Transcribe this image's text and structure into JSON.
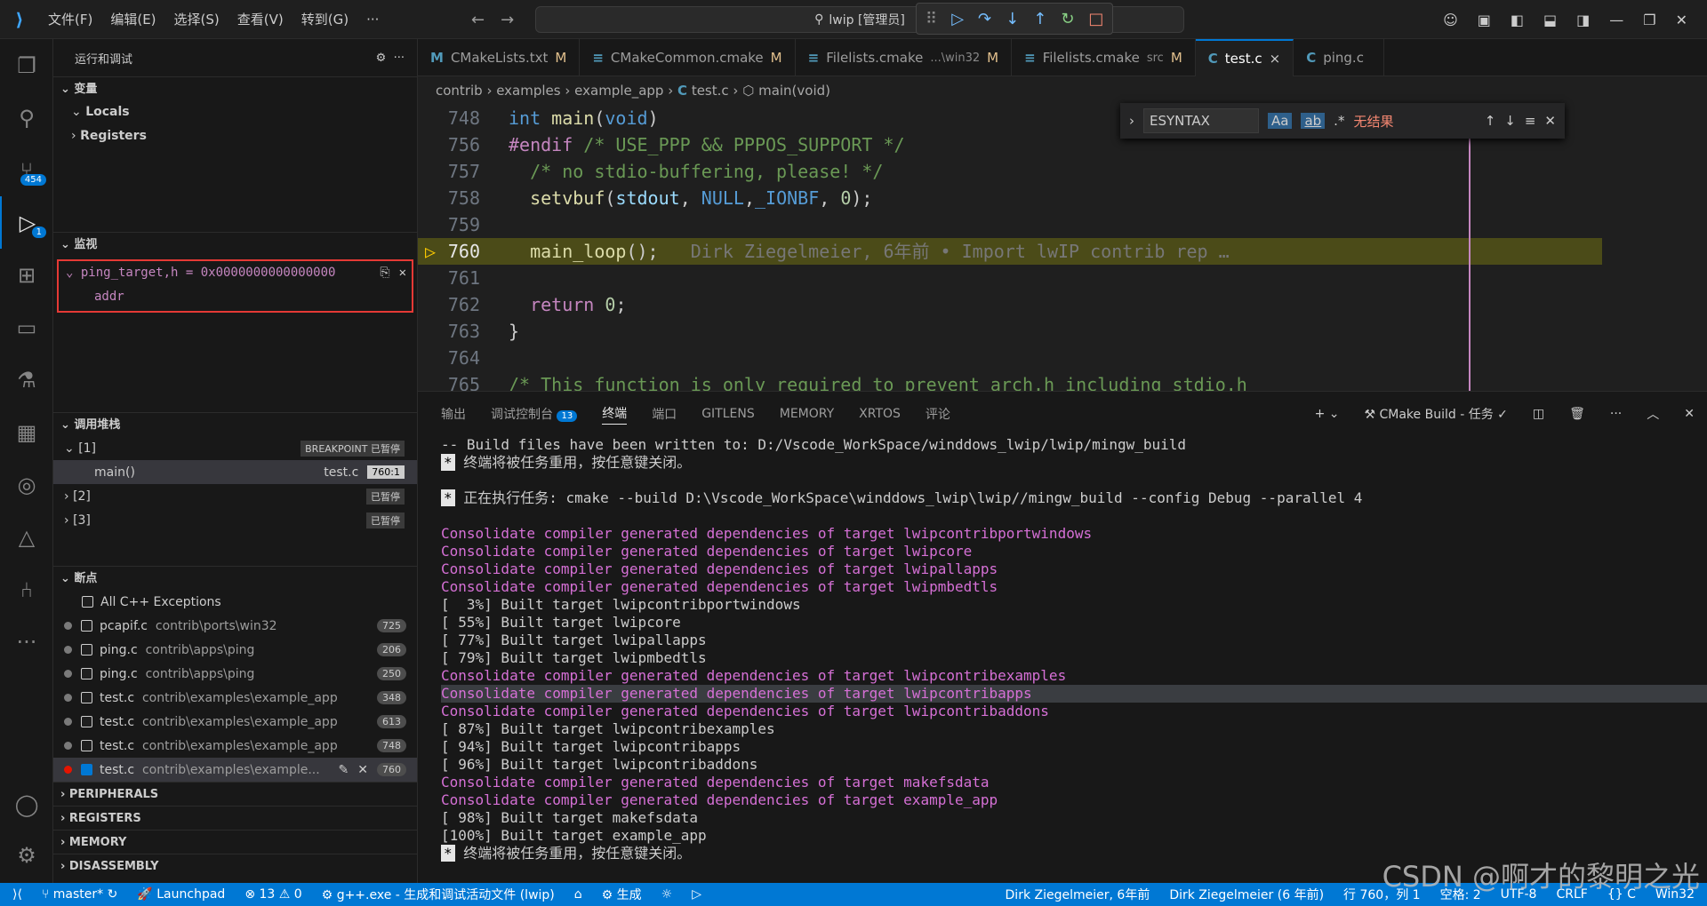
{
  "titlebar": {
    "menu": [
      "文件(F)",
      "编辑(E)",
      "选择(S)",
      "查看(V)",
      "转到(G)",
      "···"
    ],
    "search": "lwip [管理员]"
  },
  "activity": {
    "scm_badge": "454",
    "debug_badge": "1"
  },
  "sidebar": {
    "header": "运行和调试",
    "variables": {
      "title": "变量",
      "locals": "Locals",
      "registers": "Registers"
    },
    "watch": {
      "title": "监视",
      "expr": "ping_target,h = 0x0000000000000000",
      "child": "addr"
    },
    "callstack": {
      "title": "调用堆栈",
      "threads": [
        {
          "id": "[1]",
          "status": "BREAKPOINT 已暂停"
        },
        {
          "id": "[2]",
          "status": "已暂停"
        },
        {
          "id": "[3]",
          "status": "已暂停"
        }
      ],
      "frame": {
        "name": "main()",
        "file": "test.c",
        "pos": "760:1"
      }
    },
    "breakpoints": {
      "title": "断点",
      "all": "All C++ Exceptions",
      "items": [
        {
          "file": "pcapif.c",
          "path": "contrib\\ports\\win32",
          "line": "725"
        },
        {
          "file": "ping.c",
          "path": "contrib\\apps\\ping",
          "line": "206"
        },
        {
          "file": "ping.c",
          "path": "contrib\\apps\\ping",
          "line": "250"
        },
        {
          "file": "test.c",
          "path": "contrib\\examples\\example_app",
          "line": "348"
        },
        {
          "file": "test.c",
          "path": "contrib\\examples\\example_app",
          "line": "613"
        },
        {
          "file": "test.c",
          "path": "contrib\\examples\\example_app",
          "line": "748"
        },
        {
          "file": "test.c",
          "path": "contrib\\examples\\example...",
          "line": "760"
        }
      ]
    },
    "collapsed": [
      "PERIPHERALS",
      "REGISTERS",
      "MEMORY",
      "DISASSEMBLY"
    ]
  },
  "tabs": [
    {
      "label": "CMakeLists.txt",
      "suffix": "M",
      "icon": "M"
    },
    {
      "label": "CMakeCommon.cmake",
      "suffix": "M",
      "icon": "≡"
    },
    {
      "label": "Filelists.cmake",
      "sub": "...\\win32",
      "suffix": "M",
      "icon": "≡"
    },
    {
      "label": "Filelists.cmake",
      "sub": "src",
      "suffix": "M",
      "icon": "≡"
    },
    {
      "label": "test.c",
      "suffix": "×",
      "icon": "C"
    },
    {
      "label": "ping.c",
      "suffix": "",
      "icon": "C"
    }
  ],
  "breadcrumb": [
    "contrib",
    "examples",
    "example_app",
    "test.c",
    "main(void)"
  ],
  "find": {
    "query": "ESYNTAX",
    "result": "无结果"
  },
  "editor": {
    "lines": [
      "748",
      "756",
      "757",
      "758",
      "759",
      "760",
      "761",
      "762",
      "763",
      "764",
      "765"
    ],
    "sticky": "int main(void)",
    "blame": "Dirk Ziegelmeier, 6年前 • Import lwIP contrib rep …"
  },
  "panel": {
    "tabs": [
      "输出",
      "调试控制台",
      "终端",
      "端口",
      "GITLENS",
      "MEMORY",
      "XRTOS",
      "评论"
    ],
    "console_badge": "13",
    "task": "CMake Build - 任务",
    "lines": [
      {
        "t": "-- Build files have been written to: D:/Vscode_WorkSpace/winddows_lwip/lwip/mingw_build",
        "c": ""
      },
      {
        "t": " 终端将被任务重用，按任意键关闭。",
        "c": "star"
      },
      {
        "t": "",
        "c": ""
      },
      {
        "t": " 正在执行任务: cmake --build D:\\Vscode_WorkSpace\\winddows_lwip\\lwip//mingw_build --config Debug --parallel 4",
        "c": "star"
      },
      {
        "t": "",
        "c": ""
      },
      {
        "t": "Consolidate compiler generated dependencies of target lwipcontribportwindows",
        "c": "mag"
      },
      {
        "t": "Consolidate compiler generated dependencies of target lwipcore",
        "c": "mag"
      },
      {
        "t": "Consolidate compiler generated dependencies of target lwipallapps",
        "c": "mag"
      },
      {
        "t": "Consolidate compiler generated dependencies of target lwipmbedtls",
        "c": "mag"
      },
      {
        "t": "[  3%] Built target lwipcontribportwindows",
        "c": ""
      },
      {
        "t": "[ 55%] Built target lwipcore",
        "c": ""
      },
      {
        "t": "[ 77%] Built target lwipallapps",
        "c": ""
      },
      {
        "t": "[ 79%] Built target lwipmbedtls",
        "c": ""
      },
      {
        "t": "Consolidate compiler generated dependencies of target lwipcontribexamples",
        "c": "mag"
      },
      {
        "t": "Consolidate compiler generated dependencies of target lwipcontribapps",
        "c": "mag hl"
      },
      {
        "t": "Consolidate compiler generated dependencies of target lwipcontribaddons",
        "c": "mag"
      },
      {
        "t": "[ 87%] Built target lwipcontribexamples",
        "c": ""
      },
      {
        "t": "[ 94%] Built target lwipcontribapps",
        "c": ""
      },
      {
        "t": "[ 96%] Built target lwipcontribaddons",
        "c": ""
      },
      {
        "t": "Consolidate compiler generated dependencies of target makefsdata",
        "c": "mag"
      },
      {
        "t": "Consolidate compiler generated dependencies of target example_app",
        "c": "mag"
      },
      {
        "t": "[ 98%] Built target makefsdata",
        "c": ""
      },
      {
        "t": "[100%] Built target example_app",
        "c": ""
      },
      {
        "t": " 终端将被任务重用，按任意键关闭。",
        "c": "star"
      }
    ]
  },
  "status": {
    "branch": "master*",
    "launch": "Launchpad",
    "problems": "⊗ 13 ⚠ 0",
    "task": "g++.exe - 生成和调试活动文件 (lwip)",
    "build": "生成",
    "blame1": "Dirk Ziegelmeier, 6年前",
    "blame2": "Dirk Ziegelmeier (6 年前)",
    "pos": "行 760，列 1",
    "spaces": "空格: 2",
    "enc": "UTF-8",
    "eol": "CRLF",
    "lang": "{} C",
    "platform": "Win32"
  },
  "watermark": "CSDN @啊才的黎明之光"
}
